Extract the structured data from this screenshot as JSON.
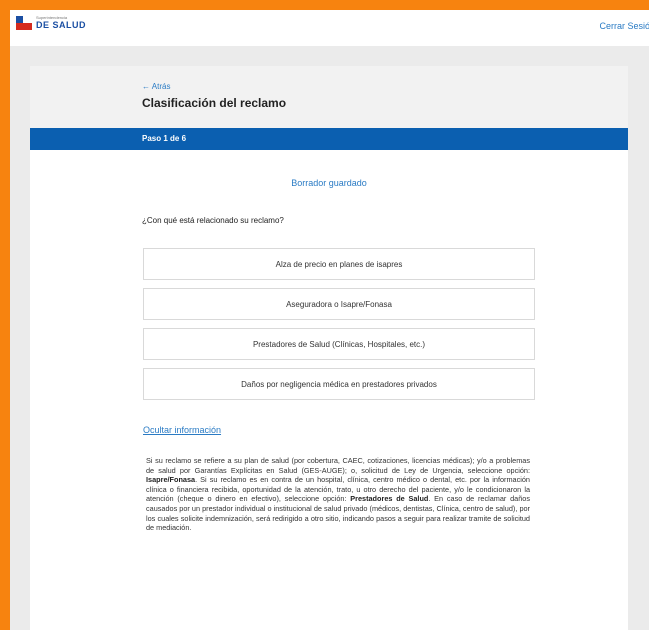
{
  "header": {
    "logo_small": "Superintendencia",
    "logo_text": "DE SALUD",
    "logout_label": "Cerrar Sesión"
  },
  "card": {
    "back_label": "← Atrás",
    "title": "Clasificación del reclamo",
    "step_label": "Paso 1 de 6",
    "draft_status": "Borrador guardado",
    "question": "¿Con qué está relacionado su reclamo?",
    "options": [
      "Alza de precio en planes de isapres",
      "Aseguradora o Isapre/Fonasa",
      "Prestadores de Salud (Clínicas, Hospitales, etc.)",
      "Daños por negligencia médica en prestadores privados"
    ],
    "toggle_info": "Ocultar información",
    "info": {
      "p1": "Si su reclamo se refiere a su plan de salud (por cobertura, CAEC, cotizaciones, licencias médicas); y/o a problemas de salud por Garantías Explícitas en Salud (GES-AUGE); o, solicitud de Ley de Urgencia, seleccione opción: ",
      "b1": "Isapre/Fonasa",
      "p2": ". Si su reclamo es en contra de un hospital, clínica, centro médico o dental, etc. por la información clínica o financiera recibida, oportunidad de la atención, trato, u otro derecho del paciente, y/o le condicionaron la atención (cheque o dinero en efectivo), seleccione opción: ",
      "b2": "Prestadores de Salud",
      "p3": ". En caso de reclamar daños causados por un prestador individual o institucional de salud privado (médicos, dentistas, Clínica, centro de salud), por los cuales solicite indemnización, será redirigido a otro sitio, indicando pasos a seguir para realizar tramite de solicitud de mediación."
    }
  },
  "colors": {
    "frame": "#f7830f",
    "step_bar": "#0b5fb0",
    "link": "#2a7bc4"
  }
}
